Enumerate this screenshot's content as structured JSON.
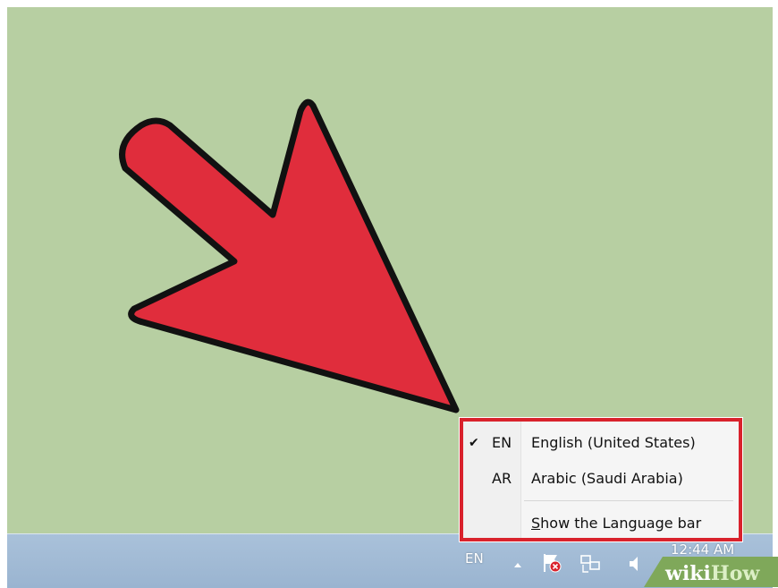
{
  "desktop": {
    "background": "#b7cfa2"
  },
  "annotation": {
    "arrow_color": "#e02d3c",
    "highlight_color": "#d9222c"
  },
  "language_menu": {
    "items": [
      {
        "check": "✔",
        "abbr": "EN",
        "label": "English (United States)",
        "selected": true
      },
      {
        "check": "",
        "abbr": "AR",
        "label": "Arabic (Saudi Arabia)",
        "selected": false
      }
    ],
    "show_bar": {
      "underlined": "S",
      "rest": "how the Language bar"
    }
  },
  "taskbar": {
    "language_indicator": "EN",
    "clock_time": "12:44 AM",
    "tray_icons": [
      "show-hidden-icons-icon",
      "action-center-flag-icon",
      "network-icon",
      "volume-icon"
    ]
  },
  "watermark": {
    "wiki": "wiki",
    "how": "How"
  }
}
